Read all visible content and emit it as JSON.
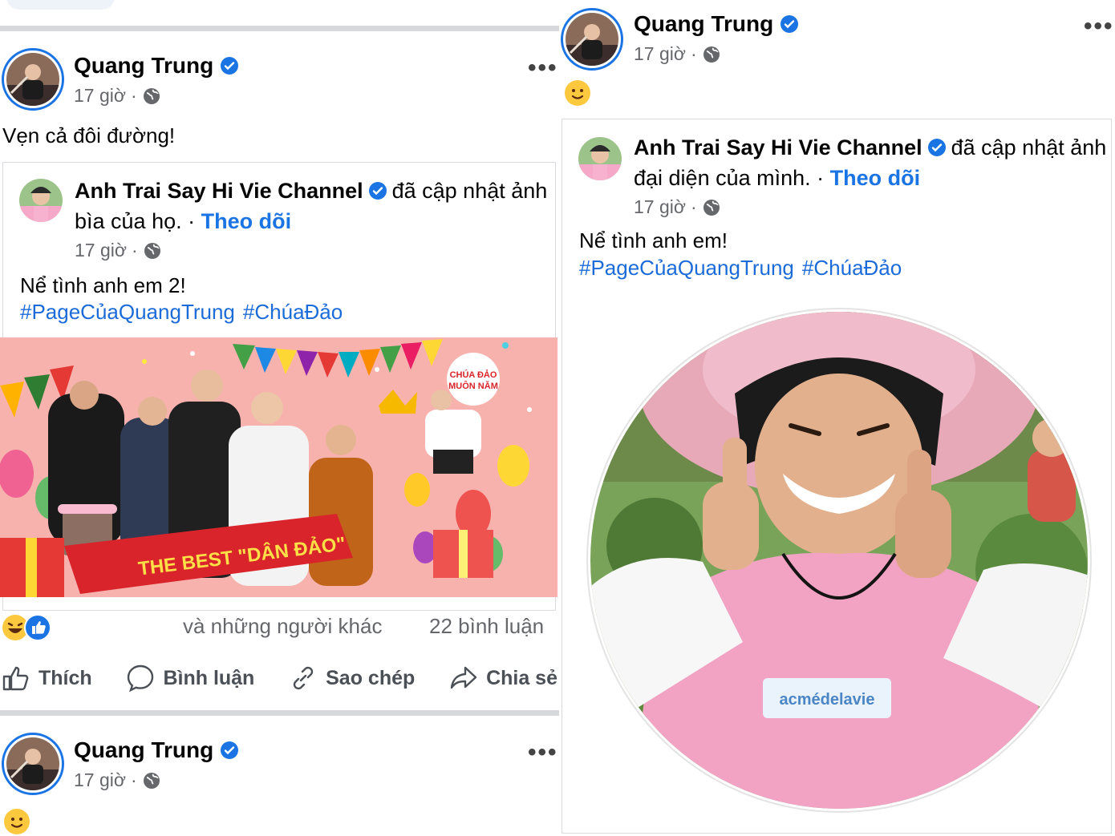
{
  "left": {
    "post1": {
      "author": "Quang Trung",
      "time": "17 giờ",
      "dot": "·",
      "caption": "Vẹn cả đôi đường!",
      "shared": {
        "page_name": "Anh Trai Say Hi Vie Channel",
        "action": "đã cập nhật ảnh bìa của họ.",
        "dot": "·",
        "follow": "Theo dõi",
        "time": "17 giờ",
        "dot2": "·",
        "text": "Nể tình anh em 2!",
        "hashtags": [
          "#PageCủaQuangTrung",
          "#ChúaĐảo"
        ],
        "cover_texts": {
          "banner": "THE BEST \"DÂN ĐẢO\"",
          "badge_line1": "CHÚA ĐẢO",
          "badge_line2": "MUÔN NĂM"
        }
      },
      "stats": {
        "others": "và những người khác",
        "comments": "22 bình luận"
      },
      "actions": [
        {
          "icon": "like-icon",
          "label": "Thích"
        },
        {
          "icon": "comment-icon",
          "label": "Bình luận"
        },
        {
          "icon": "link-icon",
          "label": "Sao chép"
        },
        {
          "icon": "share-icon",
          "label": "Chia sẻ"
        }
      ]
    },
    "post2": {
      "author": "Quang Trung",
      "time": "17 giờ",
      "dot": "·"
    }
  },
  "right": {
    "post": {
      "author": "Quang Trung",
      "time": "17 giờ",
      "dot": "·",
      "shared": {
        "page_name": "Anh Trai Say Hi Vie Channel",
        "action": "đã cập nhật ảnh đại diện của mình.",
        "dot": "·",
        "follow": "Theo dõi",
        "time": "17 giờ",
        "dot2": "·",
        "text": "Nể tình anh em!",
        "hashtags": [
          "#PageCủaQuangTrung",
          "#ChúaĐảo"
        ],
        "shirt_label": "acmédelavie"
      }
    }
  },
  "colors": {
    "link_blue": "#1b74e4",
    "hashtag_blue": "#1b6bd9",
    "meta_gray": "#65676b",
    "cover_bg": "#f4a1a1",
    "banner_red": "#d9242b",
    "shirt_pink": "#f2a3c4"
  }
}
